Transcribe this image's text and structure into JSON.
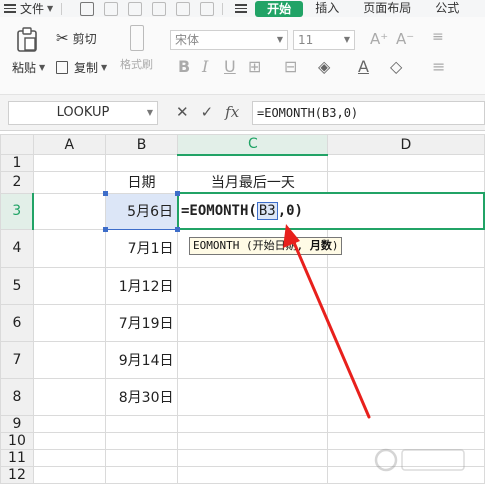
{
  "menu": {
    "file_label": "文件",
    "tabs": [
      "开始",
      "插入",
      "页面布局",
      "公式"
    ]
  },
  "ribbon": {
    "paste_label": "粘贴",
    "cut_label": "剪切",
    "copy_label": "复制",
    "format_painter_label": "格式刷",
    "font_name": "宋体",
    "font_size": "11"
  },
  "formula_bar": {
    "name_box": "LOOKUP",
    "fx_label": "fx",
    "formula": "=EOMONTH(B3,0)"
  },
  "sheet": {
    "columns": [
      "A",
      "B",
      "C",
      "D"
    ],
    "rows": [
      "1",
      "2",
      "3",
      "4",
      "5",
      "6",
      "7",
      "8",
      "9",
      "10",
      "11",
      "12"
    ],
    "header_b2": "日期",
    "header_c2": "当月最后一天",
    "dates": [
      "5月6日",
      "7月1日",
      "1月12日",
      "7月19日",
      "9月14日",
      "8月30日"
    ],
    "c3_prefix": "=EOMONTH(",
    "c3_ref": "B3",
    "c3_suffix": ",0)"
  },
  "tooltip": {
    "prefix": "EOMONTH (开始日期, ",
    "bold_arg": "月数",
    "suffix": ")"
  },
  "colors": {
    "accent_green": "#21a366",
    "ref_blue": "#3d6dc9",
    "arrow_red": "#e8201c"
  }
}
